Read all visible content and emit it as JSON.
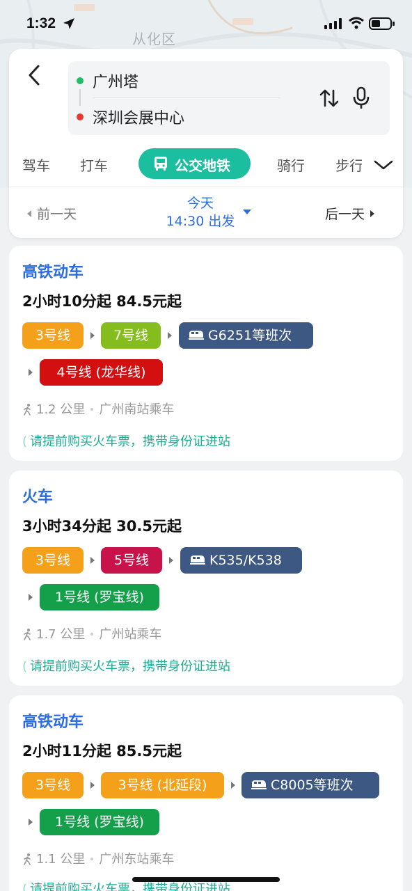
{
  "status": {
    "time": "1:32"
  },
  "map": {
    "district_label": "从化区"
  },
  "search": {
    "start": "广州塔",
    "end": "深圳会展中心",
    "modes": [
      "驾车",
      "打车",
      "公交地铁",
      "骑行",
      "步行"
    ],
    "active_mode": "公交地铁"
  },
  "date_bar": {
    "prev": "前一天",
    "day": "今天",
    "depart": "14:30 出发",
    "next": "后一天"
  },
  "results": [
    {
      "title": "高铁动车",
      "summary": "2小时10分起  84.5元起",
      "segments": [
        {
          "label": "3号线",
          "color": "#f5a01a"
        },
        {
          "label": "7号线",
          "color": "#86bd1e"
        },
        {
          "label": "G6251等班次",
          "color": "#3c5883"
        },
        {
          "label": "4号线 (龙华线)",
          "color": "#d40f0f"
        }
      ],
      "walk": "1.2 公里",
      "station": "广州南站乘车",
      "notice": "请提前购买火车票，携带身份证进站"
    },
    {
      "title": "火车",
      "summary": "3小时34分起  30.5元起",
      "segments": [
        {
          "label": "3号线",
          "color": "#f5a01a"
        },
        {
          "label": "5号线",
          "color": "#c8124a"
        },
        {
          "label": "K535/K538",
          "color": "#3c5883"
        },
        {
          "label": "1号线 (罗宝线)",
          "color": "#14a04b"
        }
      ],
      "walk": "1.7 公里",
      "station": "广州站乘车",
      "notice": "请提前购买火车票，携带身份证进站"
    },
    {
      "title": "高铁动车",
      "summary": "2小时11分起  85.5元起",
      "segments": [
        {
          "label": "3号线",
          "color": "#f5a01a"
        },
        {
          "label": "3号线 (北延段)",
          "color": "#f5a01a"
        },
        {
          "label": "C8005等班次",
          "color": "#3c5883"
        },
        {
          "label": "1号线 (罗宝线)",
          "color": "#14a04b"
        }
      ],
      "walk": "1.1 公里",
      "station": "广州东站乘车",
      "notice": "请提前购买火车票，携带身份证进站"
    }
  ]
}
